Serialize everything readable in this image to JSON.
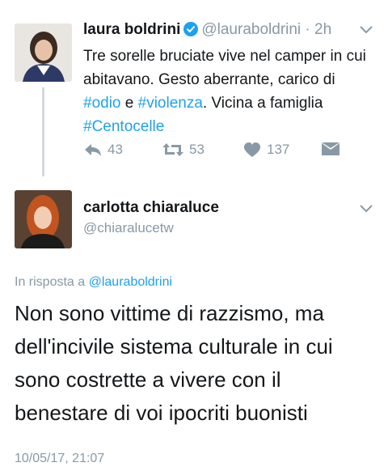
{
  "tweet": {
    "author_name": "laura boldrini",
    "author_handle": "@lauraboldrini",
    "time_ago": "2h",
    "text_parts": [
      "Tre sorelle bruciate vive nel camper in cui abitavano. Gesto aberrante, carico di ",
      "#odio",
      " e ",
      "#violenza",
      ". Vicina a famiglia ",
      "#Centocelle"
    ],
    "reply_count": "43",
    "retweet_count": "53",
    "like_count": "137"
  },
  "reply": {
    "author_name": "carlotta chiaraluce",
    "author_handle": "@chiaralucetw",
    "reply_prefix": "In risposta a",
    "reply_to_handle": "@lauraboldrini",
    "text": "Non sono vittime di razzismo, ma dell'incivile sistema culturale in cui sono costrette a vivere con il benestare di voi ipocriti buonisti",
    "timestamp": "10/05/17, 21:07"
  },
  "colors": {
    "link": "#1da1f2",
    "muted": "#8899a6",
    "text": "#14171a"
  },
  "icons": [
    "verified-badge-icon",
    "chevron-down-icon",
    "reply-icon",
    "retweet-icon",
    "heart-icon",
    "direct-message-icon"
  ]
}
